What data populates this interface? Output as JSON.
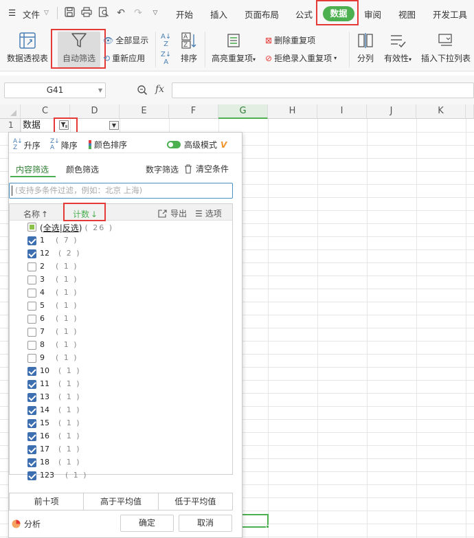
{
  "menubar": {
    "file": "文件",
    "tabs": [
      "开始",
      "插入",
      "页面布局",
      "公式",
      "数据",
      "审阅",
      "视图",
      "开发工具"
    ]
  },
  "ribbon": {
    "pivot": "数据透视表",
    "autofilter": "自动筛选",
    "show_all": "全部显示",
    "reapply": "重新应用",
    "sort": "排序",
    "highlight_dup": "高亮重复项",
    "remove_dup": "删除重复项",
    "reject_dup": "拒绝录入重复项",
    "split": "分列",
    "validity": "有效性",
    "insert_dropdown": "插入下拉列表"
  },
  "formula": {
    "cell_ref": "G41",
    "fx": "fx"
  },
  "grid": {
    "columns": [
      "C",
      "D",
      "E",
      "F",
      "G",
      "H",
      "I",
      "J",
      "K"
    ],
    "selected_column": "G",
    "row1_num": "1",
    "cell_c1": "数据"
  },
  "accent": "#4caf50",
  "highlight": "#e53935",
  "panel": {
    "asc": "升序",
    "desc": "降序",
    "color_sort": "颜色排序",
    "advanced": "高级模式",
    "advanced_on": true,
    "tab_content": "内容筛选",
    "tab_color": "颜色筛选",
    "number_filter": "数字筛选",
    "clear": "清空条件",
    "search_placeholder": "(支持多条件过滤，例如：北京  上海)",
    "col_name": "名称",
    "col_count": "计数",
    "export": "导出",
    "options": "选项",
    "select_all": "全选",
    "invert": "反选",
    "total": "( 26 )",
    "items": [
      {
        "label": "1",
        "count": "( 7 )",
        "checked": true
      },
      {
        "label": "12",
        "count": "( 2 )",
        "checked": true
      },
      {
        "label": "2",
        "count": "( 1 )",
        "checked": false
      },
      {
        "label": "3",
        "count": "( 1 )",
        "checked": false
      },
      {
        "label": "4",
        "count": "( 1 )",
        "checked": false
      },
      {
        "label": "5",
        "count": "( 1 )",
        "checked": false
      },
      {
        "label": "6",
        "count": "( 1 )",
        "checked": false
      },
      {
        "label": "7",
        "count": "( 1 )",
        "checked": false
      },
      {
        "label": "8",
        "count": "( 1 )",
        "checked": false
      },
      {
        "label": "9",
        "count": "( 1 )",
        "checked": false
      },
      {
        "label": "10",
        "count": "( 1 )",
        "checked": true
      },
      {
        "label": "11",
        "count": "( 1 )",
        "checked": true
      },
      {
        "label": "13",
        "count": "( 1 )",
        "checked": true
      },
      {
        "label": "14",
        "count": "( 1 )",
        "checked": true
      },
      {
        "label": "15",
        "count": "( 1 )",
        "checked": true
      },
      {
        "label": "16",
        "count": "( 1 )",
        "checked": true
      },
      {
        "label": "17",
        "count": "( 1 )",
        "checked": true
      },
      {
        "label": "18",
        "count": "( 1 )",
        "checked": true
      },
      {
        "label": "123",
        "count": "( 1 )",
        "checked": true
      }
    ],
    "top10": "前十项",
    "above_avg": "高于平均值",
    "below_avg": "低于平均值",
    "analysis": "分析",
    "ok": "确定",
    "cancel": "取消"
  }
}
